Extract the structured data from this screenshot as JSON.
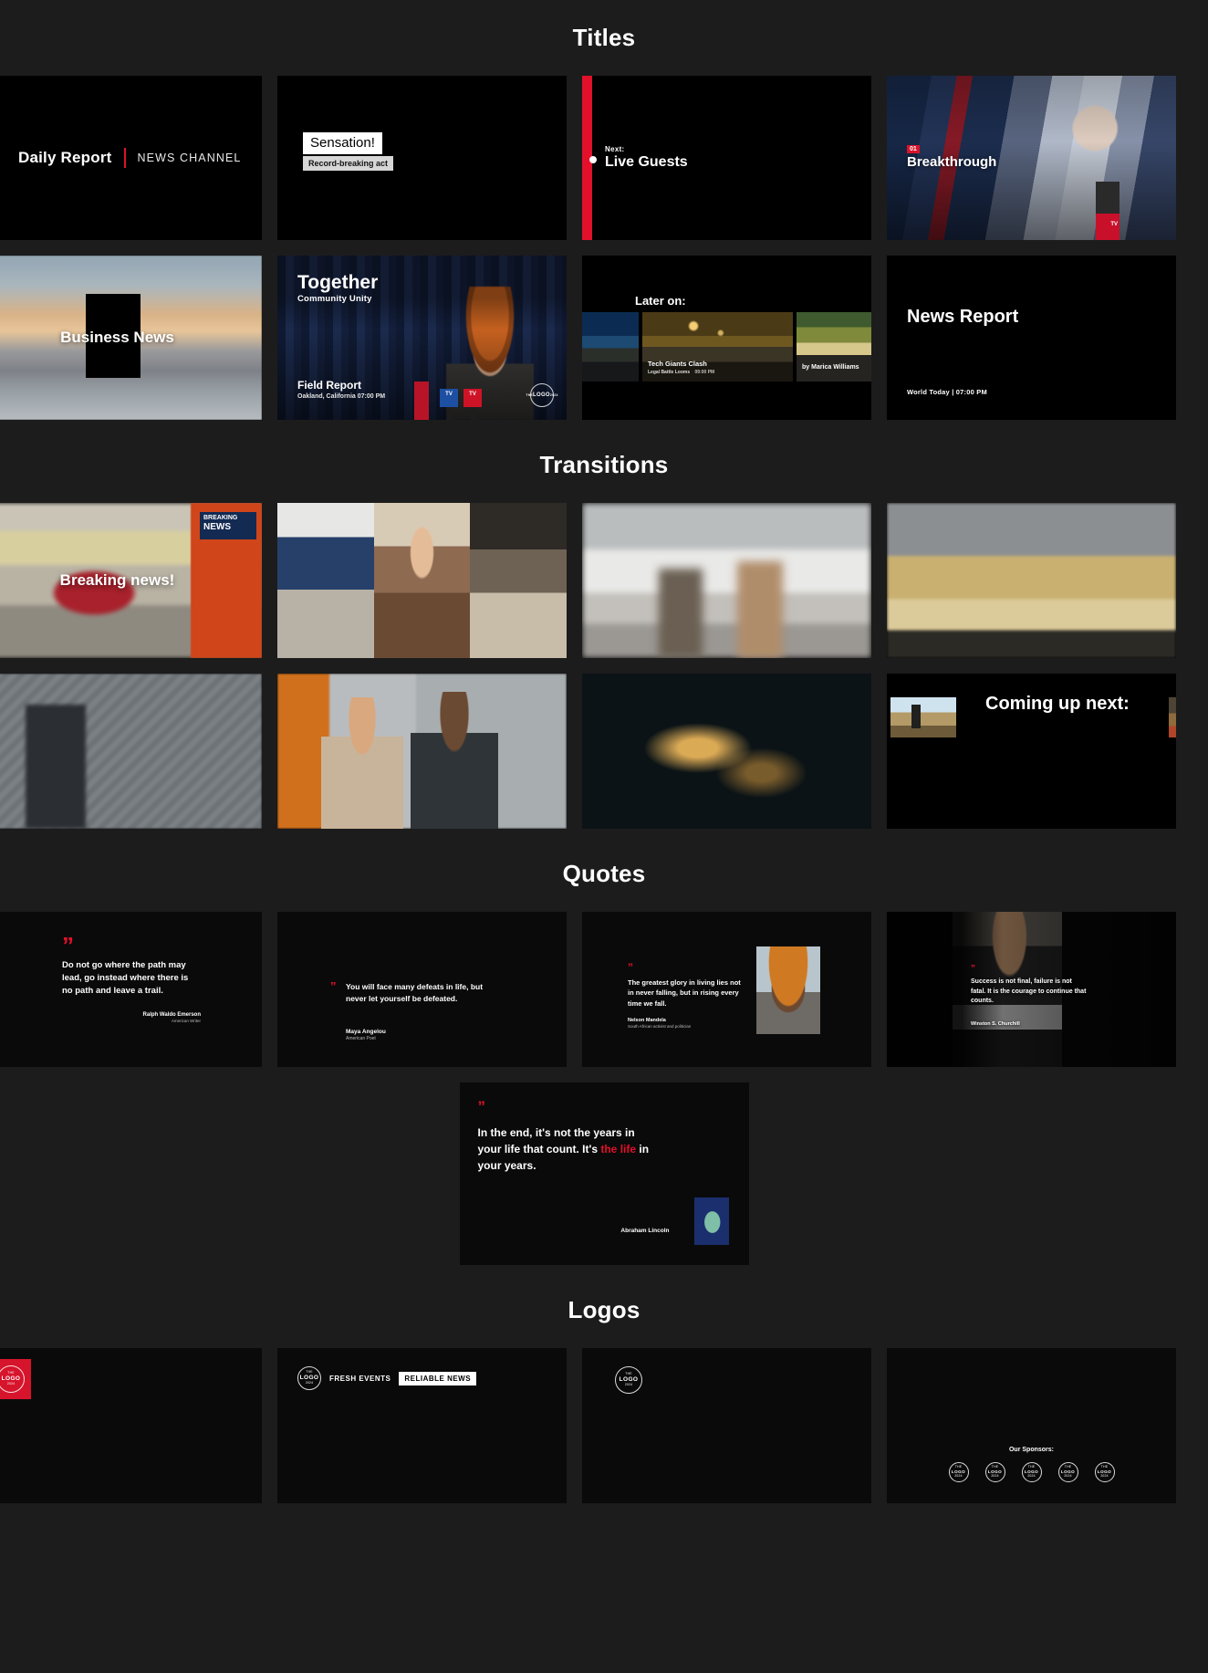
{
  "sections": [
    {
      "id": "titles",
      "title": "Titles"
    },
    {
      "id": "transitions",
      "title": "Transitions"
    },
    {
      "id": "quotes",
      "title": "Quotes"
    },
    {
      "id": "logos",
      "title": "Logos"
    }
  ],
  "colors": {
    "accent_red": "#e3102b",
    "badge_red": "#d6142c",
    "page_bg": "#1c1c1c",
    "card_bg": "#000000"
  },
  "titles": {
    "daily_report": {
      "main": "Daily Report",
      "divider": "|",
      "sub": "NEWS CHANNEL"
    },
    "sensation": {
      "headline": "Sensation!",
      "sub": "Record-breaking act"
    },
    "live_guests": {
      "kicker": "Next:",
      "title": "Live Guests"
    },
    "breakthrough": {
      "number": "01",
      "title": "Breakthrough",
      "mic_label": "TV"
    },
    "business_news": {
      "title": "Business News"
    },
    "together": {
      "title": "Together",
      "subtitle": "Community Unity",
      "footer_title": "Field Report",
      "footer_sub": "Oakland, California 07:00 PM",
      "mic_left_label": "TV",
      "mic_right_label": "TV",
      "logo_top": "THE",
      "logo_main": "LOGO",
      "logo_bottom": "2024"
    },
    "later_on": {
      "title": "Later on:",
      "center_caption": "Tech Giants Clash",
      "center_sub": "Legal Battle Looms",
      "center_time": "09:00 PM",
      "right_caption": "by Marica Williams"
    },
    "news_report": {
      "title": "News Report",
      "sub": "World Today | 07:00 PM"
    }
  },
  "transitions": {
    "breaking_news": {
      "text": "Breaking news!",
      "van_badge_line1": "BREAKING",
      "van_badge_line2": "NEWS"
    },
    "coming_up": {
      "text": "Coming up next:"
    }
  },
  "quotes": [
    {
      "id": "quote-emerson",
      "text": "Do not go where the path may lead, go instead where there is no path and leave a trail.",
      "author": "Ralph Waldo Emerson",
      "role": "American Writer"
    },
    {
      "id": "quote-angelou",
      "text": "You will face many defeats in life, but never let yourself be defeated.",
      "author": "Maya Angelou",
      "role": "American Poet"
    },
    {
      "id": "quote-mandela",
      "text": "The greatest glory in living lies not in never falling, but in rising every time we fall.",
      "author": "Nelson Mandela",
      "role": "South African activist and politician"
    },
    {
      "id": "quote-churchill",
      "text": "Success is not final, failure is not fatal. It is the courage to continue that counts.",
      "author": "Winston S. Churchill",
      "role": ""
    },
    {
      "id": "quote-lincoln",
      "text_part1": "In the end, it's not the years in your life that count. It's ",
      "text_highlight": "the life",
      "text_part2": " in your years.",
      "author": "Abraham Lincoln",
      "role": ""
    }
  ],
  "logos": {
    "logo_mark": {
      "top": "THE",
      "main": "LOGO",
      "bottom": "2024"
    },
    "fresh_events": "FRESH EVENTS",
    "reliable_news": "RELIABLE NEWS",
    "sponsors_title": "Our Sponsors:",
    "sponsor_count": 5
  },
  "quote_mark_glyph": "”"
}
